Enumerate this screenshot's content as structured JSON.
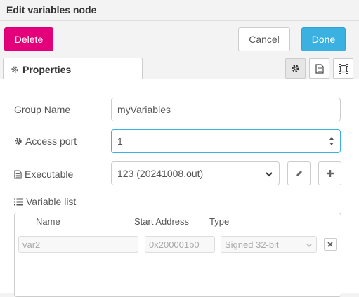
{
  "window": {
    "title": "Edit variables node"
  },
  "toolbar": {
    "delete_label": "Delete",
    "cancel_label": "Cancel",
    "done_label": "Done"
  },
  "tabs": {
    "properties_label": "Properties"
  },
  "form": {
    "group_name_label": "Group Name",
    "group_name_value": "myVariables",
    "access_port_label": "Access port",
    "access_port_value": "1",
    "executable_label": "Executable",
    "executable_value": "123 (20241008.out)",
    "variable_list_label": "Variable list"
  },
  "variable_table": {
    "columns": [
      "Name",
      "Start Address",
      "Type"
    ],
    "rows": [
      {
        "name": "var2",
        "start_address": "0x200001b0",
        "type": "Signed 32-bit"
      }
    ]
  },
  "colors": {
    "delete": "#e4007a",
    "done": "#3ab1e0",
    "focus": "#3ab1e0"
  }
}
